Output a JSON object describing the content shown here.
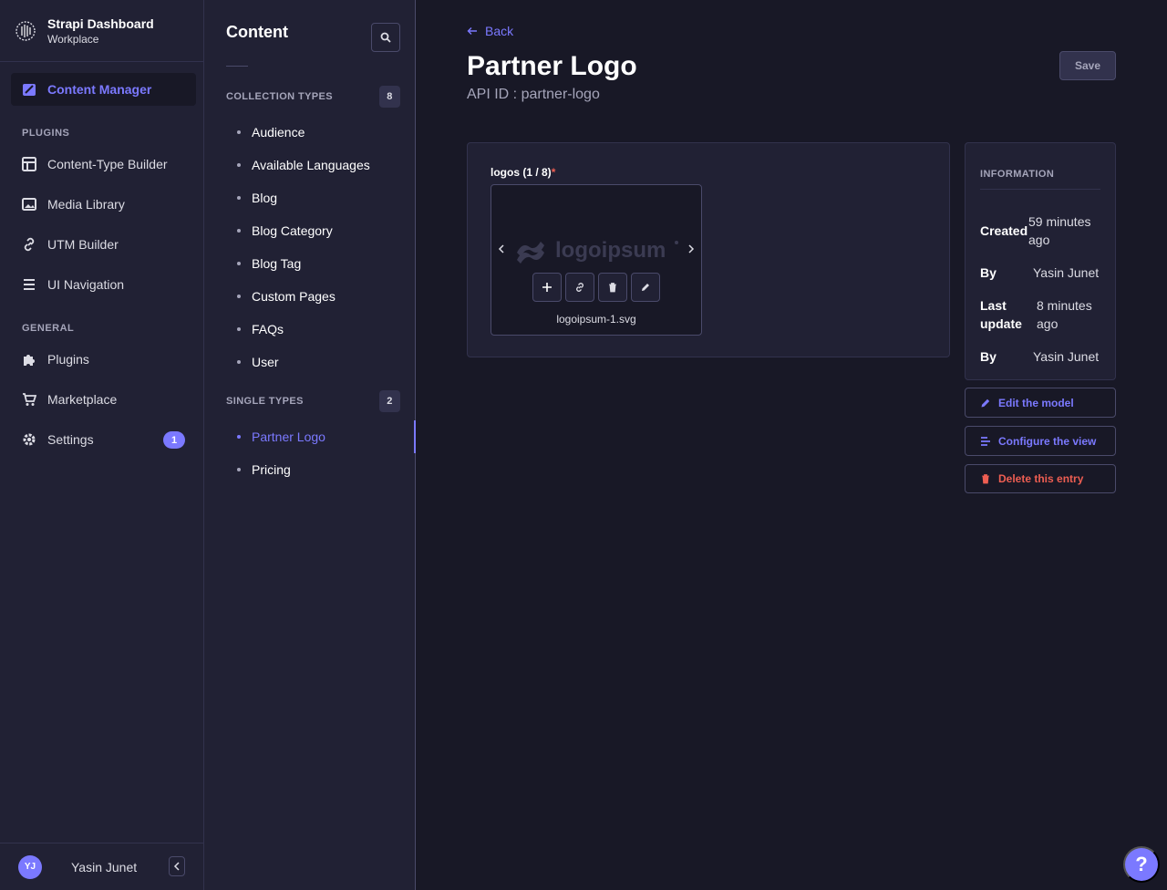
{
  "brand": {
    "title": "Strapi Dashboard",
    "subtitle": "Workplace"
  },
  "mainnav": {
    "active": {
      "label": "Content Manager",
      "icon": "feather-icon"
    },
    "plugins_heading": "PLUGINS",
    "plugins": [
      {
        "label": "Content-Type Builder",
        "icon": "layout-icon"
      },
      {
        "label": "Media Library",
        "icon": "image-icon"
      },
      {
        "label": "UTM Builder",
        "icon": "link-icon"
      },
      {
        "label": "UI Navigation",
        "icon": "list-icon"
      }
    ],
    "general_heading": "GENERAL",
    "general": [
      {
        "label": "Plugins",
        "icon": "puzzle-icon"
      },
      {
        "label": "Marketplace",
        "icon": "cart-icon"
      },
      {
        "label": "Settings",
        "icon": "gear-icon",
        "badge": "1"
      }
    ]
  },
  "user": {
    "initials": "YJ",
    "name": "Yasin Junet"
  },
  "subnav": {
    "title": "Content",
    "collection_heading": "COLLECTION TYPES",
    "collection_count": "8",
    "collection_items": [
      "Audience",
      "Available Languages",
      "Blog",
      "Blog Category",
      "Blog Tag",
      "Custom Pages",
      "FAQs",
      "User"
    ],
    "single_heading": "SINGLE TYPES",
    "single_count": "2",
    "single_items": [
      "Partner Logo",
      "Pricing"
    ]
  },
  "page": {
    "back_label": "Back",
    "title": "Partner Logo",
    "api_id": "API ID : partner-logo",
    "save_label": "Save"
  },
  "field": {
    "label": "logos (1 / 8)",
    "required_mark": "*",
    "file_name": "logoipsum-1.svg",
    "logo_text": "logoipsum"
  },
  "info": {
    "heading": "INFORMATION",
    "created_label": "Created",
    "created_value": "59 minutes ago",
    "by_label": "By",
    "created_by": "Yasin Junet",
    "updated_label": "Last update",
    "updated_value": "8 minutes ago",
    "updated_by": "Yasin Junet"
  },
  "side_actions": {
    "edit_model": "Edit the model",
    "configure_view": "Configure the view",
    "delete_entry": "Delete this entry"
  },
  "help_label": "?",
  "colors": {
    "accent": "#7b79ff",
    "danger": "#ee5e52",
    "background": "#181826",
    "panel": "#212134"
  }
}
